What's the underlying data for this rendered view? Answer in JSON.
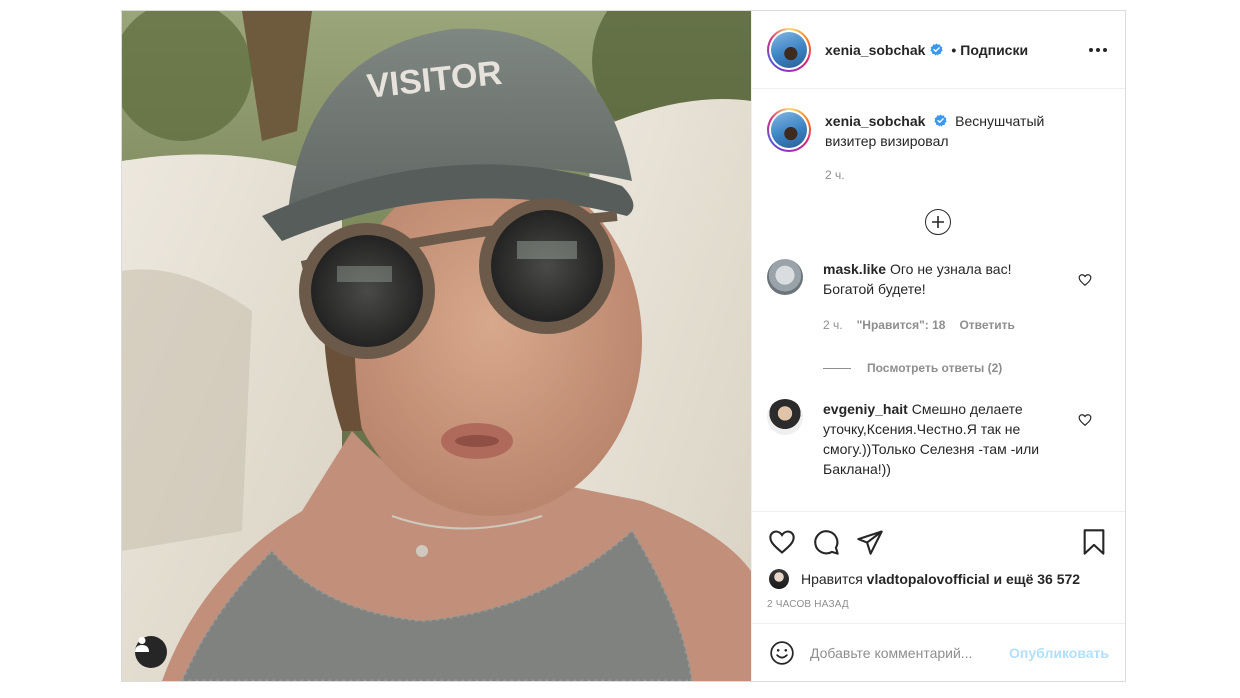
{
  "post": {
    "author": "xenia_sobchak",
    "follow_sep": "•",
    "follow_label": "Подписки",
    "caption_text": "Веснушчатый визитер визировал",
    "caption_time": "2 ч.",
    "photo_cap_text": "VISITOR"
  },
  "comments": [
    {
      "user": "mask.like",
      "text": "Ого не узнала вас! Богатой будете!",
      "time": "2 ч.",
      "likes": "\"Нравится\": 18",
      "reply": "Ответить",
      "view_replies": "Посмотреть ответы (2)"
    },
    {
      "user": "evgeniy_hait",
      "text": "Смешно делаете уточку,Ксения.Честно.Я так не смогу.))Только Селезня -там -или Баклана!))"
    }
  ],
  "actions": {
    "likes_prefix": "Нравится",
    "likes_user": "vladtopalovofficial",
    "likes_suffix": "и ещё 36 572",
    "time_ago": "2 часов назад",
    "comment_placeholder": "Добавьте комментарий...",
    "publish_label": "Опубликовать"
  },
  "icons": {
    "verified": "verified-badge-icon",
    "more": "more-options-icon",
    "load_more": "plus-circle-icon",
    "like": "heart-icon",
    "comment": "comment-bubble-icon",
    "share": "paper-plane-icon",
    "save": "bookmark-icon",
    "emoji": "smiley-icon",
    "tagged": "user-tag-icon"
  },
  "colors": {
    "verified_blue": "#3897f0",
    "publish_disabled": "#b2dffc",
    "muted_text": "#8e8e8e",
    "primary_text": "#262626"
  }
}
